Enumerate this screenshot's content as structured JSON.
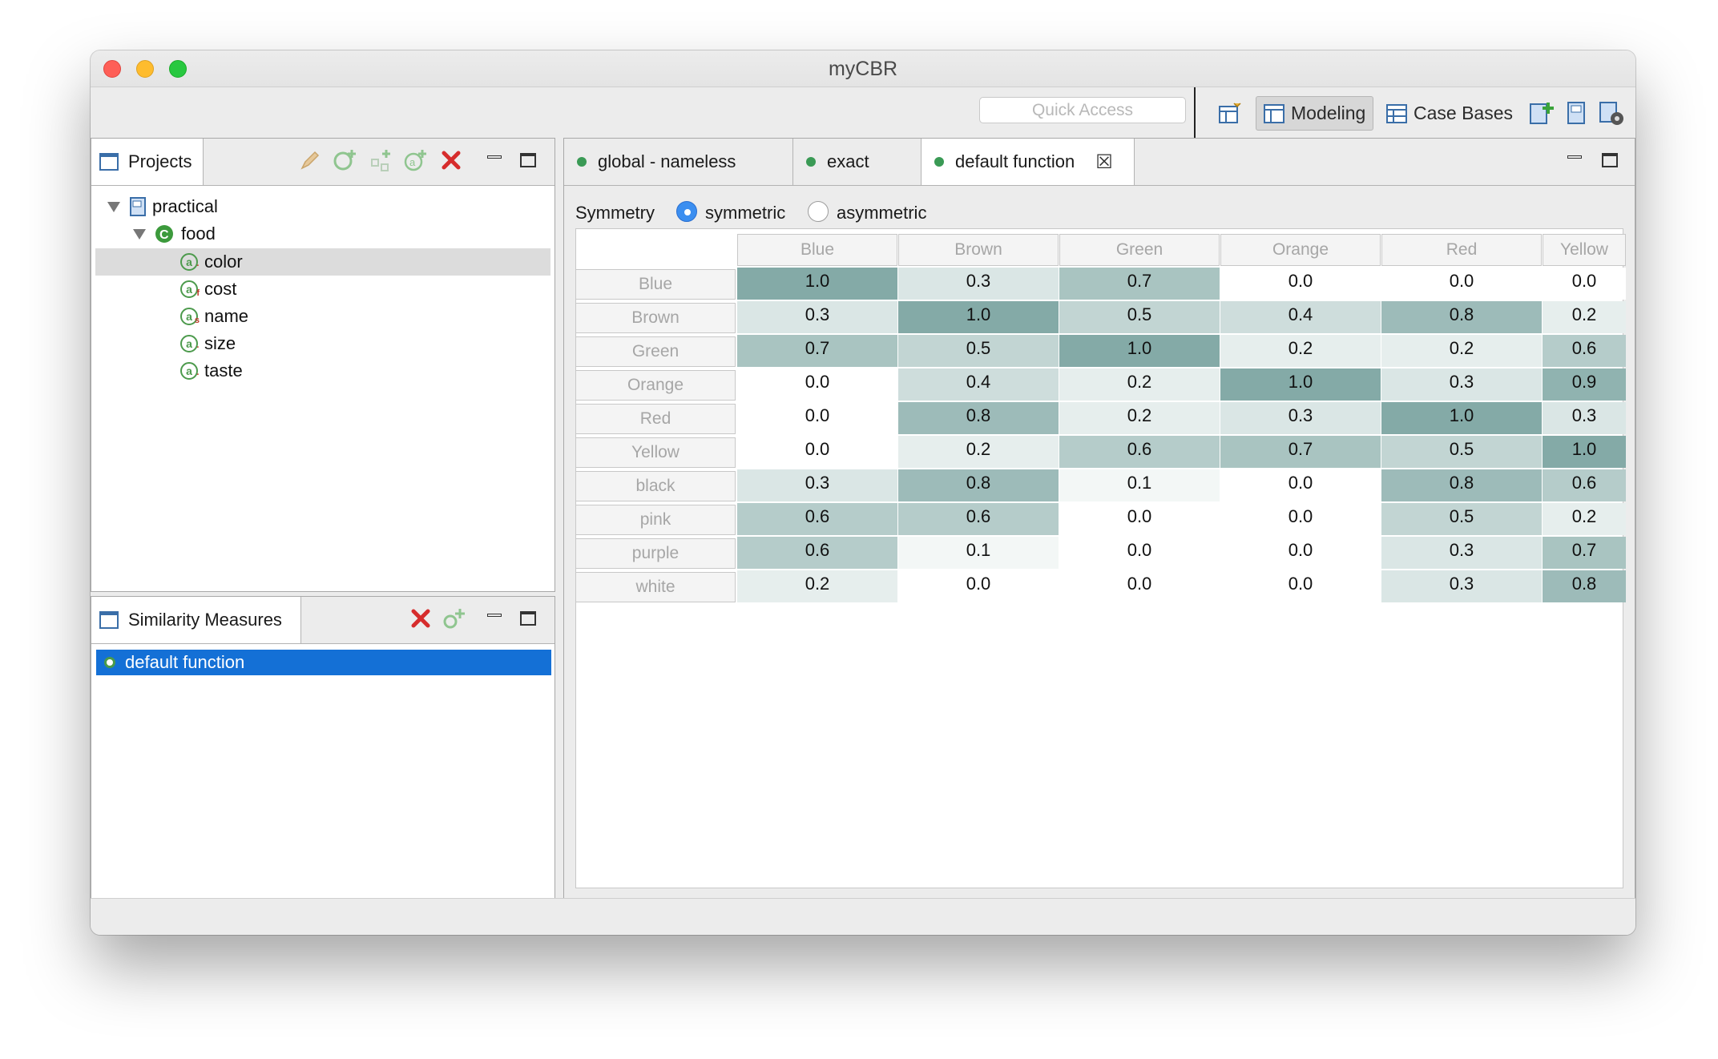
{
  "window": {
    "title": "myCBR"
  },
  "toolbar": {
    "quick_access_placeholder": "Quick Access",
    "perspectives": [
      {
        "label": "Modeling",
        "active": true
      },
      {
        "label": "Case Bases",
        "active": false
      }
    ]
  },
  "projects_view": {
    "title": "Projects",
    "tree": {
      "project": "practical",
      "concept": "food",
      "attributes": [
        "color",
        "cost",
        "name",
        "size",
        "taste"
      ],
      "selected": "color"
    }
  },
  "similarity_view": {
    "title": "Similarity Measures",
    "items": [
      "default function"
    ],
    "selected": "default function"
  },
  "editor": {
    "tabs": [
      "global - nameless",
      "exact",
      "default function"
    ],
    "active_tab": "default function",
    "symmetry_label": "Symmetry",
    "symmetric_label": "symmetric",
    "asymmetric_label": "asymmetric",
    "symmetry_value": "symmetric",
    "matrix": {
      "columns": [
        "Blue",
        "Brown",
        "Green",
        "Orange",
        "Red",
        "Yellow"
      ],
      "rows": [
        {
          "label": "Blue",
          "values": [
            "1.0",
            "0.3",
            "0.7",
            "0.0",
            "0.0",
            "0.0"
          ]
        },
        {
          "label": "Brown",
          "values": [
            "0.3",
            "1.0",
            "0.5",
            "0.4",
            "0.8",
            "0.2"
          ]
        },
        {
          "label": "Green",
          "values": [
            "0.7",
            "0.5",
            "1.0",
            "0.2",
            "0.2",
            "0.6"
          ]
        },
        {
          "label": "Orange",
          "values": [
            "0.0",
            "0.4",
            "0.2",
            "1.0",
            "0.3",
            "0.9"
          ]
        },
        {
          "label": "Red",
          "values": [
            "0.0",
            "0.8",
            "0.2",
            "0.3",
            "1.0",
            "0.3"
          ]
        },
        {
          "label": "Yellow",
          "values": [
            "0.0",
            "0.2",
            "0.6",
            "0.7",
            "0.5",
            "1.0"
          ]
        },
        {
          "label": "black",
          "values": [
            "0.3",
            "0.8",
            "0.1",
            "0.0",
            "0.8",
            "0.6"
          ]
        },
        {
          "label": "pink",
          "values": [
            "0.6",
            "0.6",
            "0.0",
            "0.0",
            "0.5",
            "0.2"
          ]
        },
        {
          "label": "purple",
          "values": [
            "0.6",
            "0.1",
            "0.0",
            "0.0",
            "0.3",
            "0.7"
          ]
        },
        {
          "label": "white",
          "values": [
            "0.2",
            "0.0",
            "0.0",
            "0.0",
            "0.3",
            "0.8"
          ]
        }
      ]
    }
  },
  "colors": {
    "selection_blue": "#1470d6",
    "cell_high": "#84aaa7",
    "status_green": "#3a9a55",
    "delete_red": "#d62c2c"
  }
}
